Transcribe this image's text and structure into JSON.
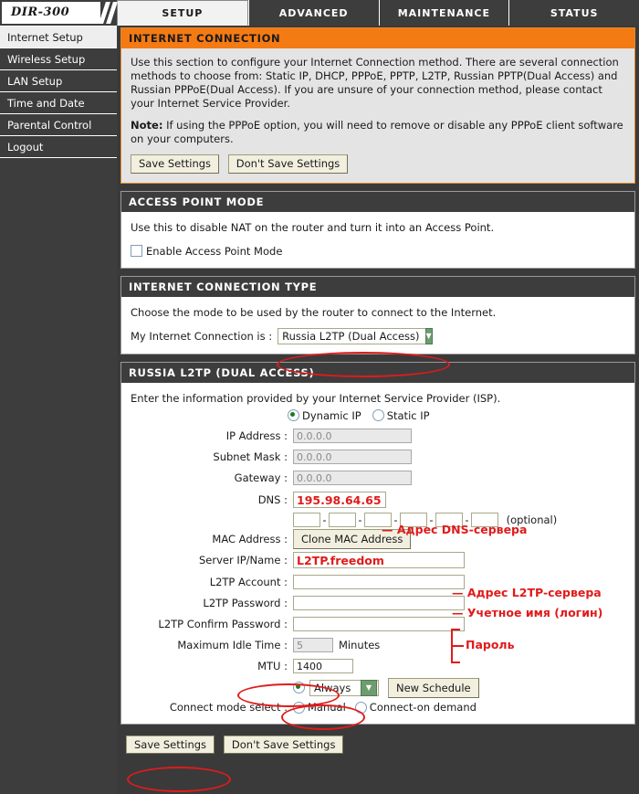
{
  "header": {
    "logo": "DIR-300",
    "tabs": [
      {
        "label": "SETUP",
        "active": true
      },
      {
        "label": "ADVANCED",
        "active": false
      },
      {
        "label": "MAINTENANCE",
        "active": false
      },
      {
        "label": "STATUS",
        "active": false
      }
    ]
  },
  "sidebar": {
    "items": [
      {
        "label": "Internet Setup",
        "active": true
      },
      {
        "label": "Wireless Setup",
        "active": false
      },
      {
        "label": "LAN Setup",
        "active": false
      },
      {
        "label": "Time and Date",
        "active": false
      },
      {
        "label": "Parental Control",
        "active": false
      },
      {
        "label": "Logout",
        "active": false
      }
    ]
  },
  "internet_connection": {
    "title": "INTERNET CONNECTION",
    "paragraph": "Use this section to configure your Internet Connection method. There are several connection methods to choose from: Static IP, DHCP, PPPoE, PPTP, L2TP, Russian PPTP(Dual Access) and Russian PPPoE(Dual Access). If you are unsure of your connection method, please contact your Internet Service Provider.",
    "note_label": "Note:",
    "note_text": " If using the PPPoE option, you will need to remove or disable any PPPoE client software on your computers.",
    "save_label": "Save Settings",
    "dont_save_label": "Don't Save Settings"
  },
  "access_point_mode": {
    "title": "ACCESS POINT MODE",
    "description": "Use this to disable NAT on the router and turn it into an Access Point.",
    "checkbox_label": "Enable Access Point Mode",
    "checked": false
  },
  "connection_type": {
    "title": "INTERNET CONNECTION TYPE",
    "description": "Choose the mode to be used by the router to connect to the Internet.",
    "select_label": "My Internet Connection is :",
    "selected": "Russia L2TP (Dual Access)"
  },
  "l2tp": {
    "title": "RUSSIA L2TP (DUAL ACCESS)",
    "description": "Enter the information provided by your Internet Service Provider (ISP).",
    "ip_mode": {
      "dynamic_label": "Dynamic IP",
      "static_label": "Static IP",
      "selected": "Dynamic IP"
    },
    "fields": {
      "ip_address_label": "IP Address :",
      "ip_address_value": "0.0.0.0",
      "subnet_mask_label": "Subnet Mask :",
      "subnet_mask_value": "0.0.0.0",
      "gateway_label": "Gateway :",
      "gateway_value": "0.0.0.0",
      "dns_label": "DNS :",
      "dns_value": "195.98.64.65",
      "mac_address_label": "MAC Address :",
      "mac_optional_label": "(optional)",
      "mac_octets": [
        "",
        "",
        "",
        "",
        "",
        ""
      ],
      "clone_mac_label": "Clone MAC Address",
      "server_label": "Server IP/Name :",
      "server_value": "L2TP.freedom",
      "account_label": "L2TP Account :",
      "account_value": "",
      "password_label": "L2TP Password :",
      "password_value": "",
      "confirm_password_label": "L2TP Confirm Password :",
      "confirm_password_value": "",
      "idle_time_label": "Maximum Idle Time :",
      "idle_time_value": "5",
      "idle_time_units": "Minutes",
      "mtu_label": "MTU :",
      "mtu_value": "1400",
      "connect_mode_label": "Connect mode select :",
      "connect_mode_selected": "Always",
      "new_schedule_label": "New Schedule",
      "manual_label": "Manual",
      "connect_on_demand_label": "Connect-on demand"
    }
  },
  "footer": {
    "save_label": "Save Settings",
    "dont_save_label": "Don't Save Settings"
  },
  "annotations": {
    "dns": "— Адрес DNS-сервера",
    "server": "— Адрес L2TP-сервера",
    "account": "— Учетное имя (логин)",
    "password": "Пароль"
  },
  "colors": {
    "accent_orange": "#f47a14",
    "dark_panel": "#3d3d3d",
    "annotation_red": "#e01b1b"
  }
}
